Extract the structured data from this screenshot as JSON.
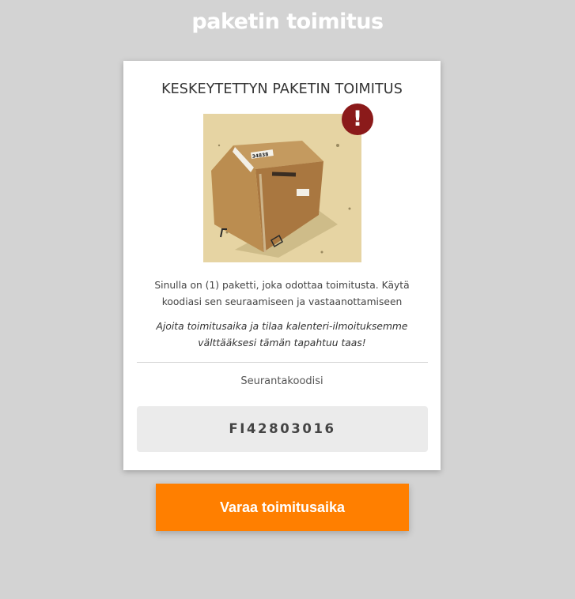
{
  "header": {
    "logo_text": "paketin toimitus"
  },
  "card": {
    "title": "KESKEYTETTYN PAKETIN TOIMITUS",
    "image": {
      "subject": "cardboard package",
      "alert_icon": "exclamation-icon",
      "alert_symbol": "!",
      "label_text": "34838"
    },
    "description": "Sinulla on (1) paketti, joka odottaa toimitusta. Käytä koodiasi sen seuraamiseen ja vastaanottamiseen",
    "note": "Ajoita toimitusaika ja tilaa kalenteri-ilmoituksemme välttääksesi tämän tapahtuu taas!",
    "tracking_label": "Seurantakoodisi",
    "tracking_code": "FI42803016"
  },
  "cta": {
    "label": "Varaa toimitusaika"
  },
  "colors": {
    "background": "#d3d3d3",
    "card": "#ffffff",
    "accent": "#ff7f00",
    "alert": "#8b1a1a",
    "tracking_box": "#ebebeb"
  }
}
